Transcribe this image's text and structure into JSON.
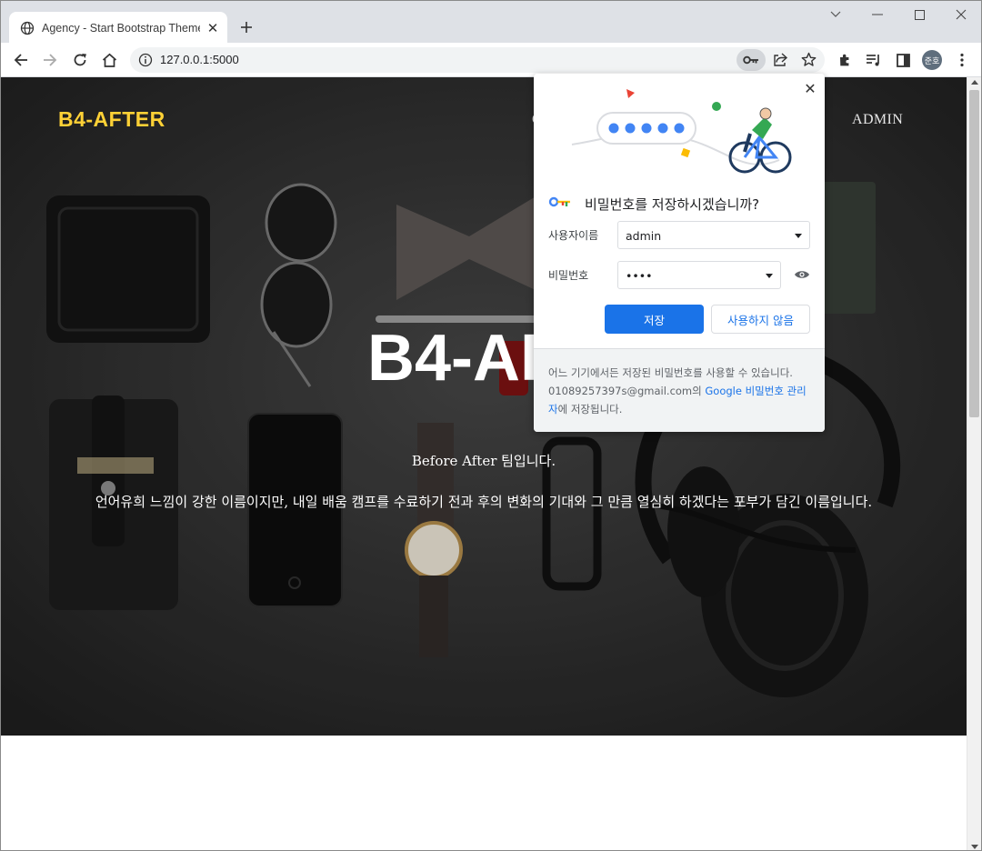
{
  "browser": {
    "tab_title": "Agency - Start Bootstrap Theme",
    "url": "127.0.0.1:5000",
    "profile_initials": "준호"
  },
  "site": {
    "brand": "B4-AFTER",
    "nav_item_partial": "C",
    "nav_admin": "ADMIN",
    "hero_heading": "B4-AFT",
    "hero_subheading": "Before After 팀입니다.",
    "hero_description": "언어유희 느낌이 강한 이름이지만, 내일 배움 캠프를 수료하기 전과 후의 변화의 기대와 그 만큼 열심히 하겠다는 포부가 담긴 이름입니다."
  },
  "password_bubble": {
    "title": "비밀번호를 저장하시겠습니까?",
    "username_label": "사용자이름",
    "username_value": "admin",
    "password_label": "비밀번호",
    "password_value": "••••",
    "save_label": "저장",
    "never_label": "사용하지 않음",
    "footer_text_1": "어느 기기에서든 저장된 비밀번호를 사용할 수 있습니다. 01089257397s@gmail.com의 ",
    "footer_link": "Google 비밀번호 관리자",
    "footer_text_2": "에 저장됩니다."
  },
  "colors": {
    "brand_yellow": "#fed136",
    "chrome_blue": "#1a73e8",
    "tabstrip": "#dee1e6"
  },
  "icons": [
    "globe-icon",
    "close-icon",
    "plus-icon",
    "minimize-icon",
    "maximize-icon",
    "window-close-icon",
    "chevron-down-icon",
    "back-icon",
    "forward-icon",
    "reload-icon",
    "home-icon",
    "info-icon",
    "key-icon",
    "share-icon",
    "star-icon",
    "extensions-icon",
    "reading-list-icon",
    "side-panel-icon",
    "menu-icon",
    "eye-icon"
  ]
}
